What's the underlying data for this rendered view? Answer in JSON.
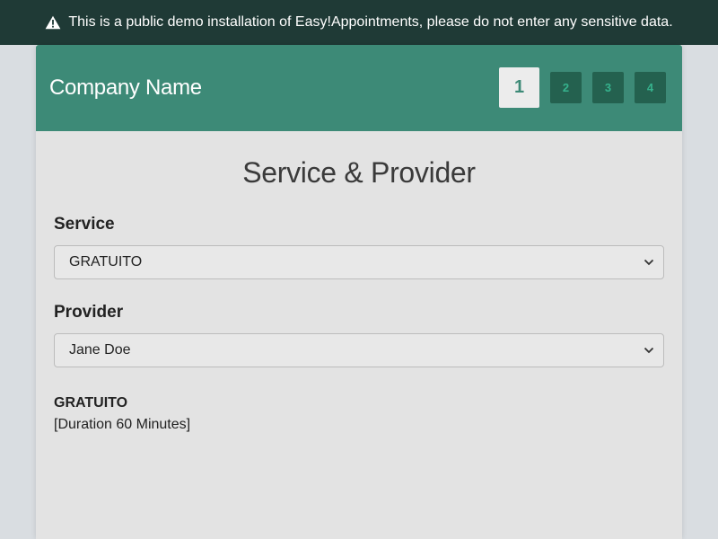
{
  "banner": {
    "icon": "warning-icon",
    "text": "This is a public demo installation of Easy!Appointments, please do not enter any sensitive data."
  },
  "header": {
    "company_name": "Company Name",
    "steps": [
      "1",
      "2",
      "3",
      "4"
    ],
    "active_step": "1"
  },
  "main": {
    "title": "Service & Provider",
    "service": {
      "label": "Service",
      "selected": "GRATUITO"
    },
    "provider": {
      "label": "Provider",
      "selected": "Jane Doe"
    },
    "details": {
      "name": "GRATUITO",
      "duration": "[Duration 60 Minutes]"
    }
  },
  "colors": {
    "banner_bg": "#1f3a36",
    "header_bg": "#3d8a77",
    "step_bg": "#24614f",
    "step_text": "#36b28d",
    "page_bg": "#d9dde1"
  }
}
